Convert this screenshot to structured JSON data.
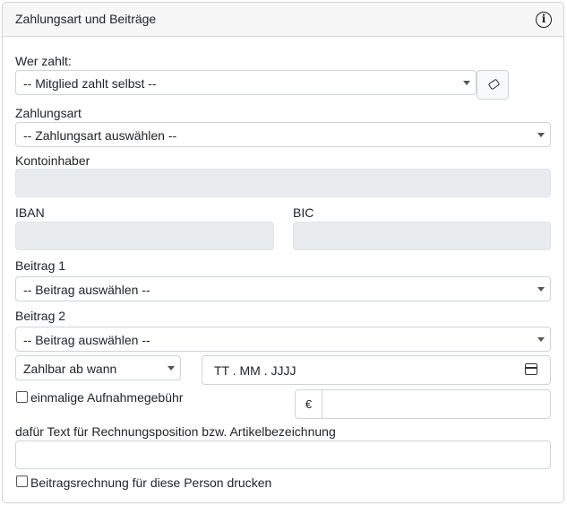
{
  "card": {
    "title": "Zahlungsart und Beiträge",
    "info_icon": "info-icon"
  },
  "wer_zahlt": {
    "label": "Wer zahlt:",
    "value": "-- Mitglied zahlt selbst --"
  },
  "zahlungsart": {
    "label": "Zahlungsart",
    "value": "-- Zahlungsart auswählen --"
  },
  "kontoinhaber": {
    "label": "Kontoinhaber",
    "value": ""
  },
  "iban": {
    "label": "IBAN",
    "value": ""
  },
  "bic": {
    "label": "BIC",
    "value": ""
  },
  "beitrag1": {
    "label": "Beitrag 1",
    "value": "-- Beitrag auswählen --"
  },
  "beitrag2": {
    "label": "Beitrag 2",
    "value": "-- Beitrag auswählen --"
  },
  "zahlbar": {
    "value": "Zahlbar ab wann"
  },
  "date": {
    "placeholder": "TT . MM . JJJJ"
  },
  "aufnahme": {
    "label": "einmalige Aufnahmegebühr",
    "currency": "€",
    "value": ""
  },
  "text_position": {
    "label": "dafür Text für Rechnungsposition bzw. Artikelbezeichnung",
    "value": ""
  },
  "drucken": {
    "label": "Beitragsrechnung für diese Person drucken"
  }
}
